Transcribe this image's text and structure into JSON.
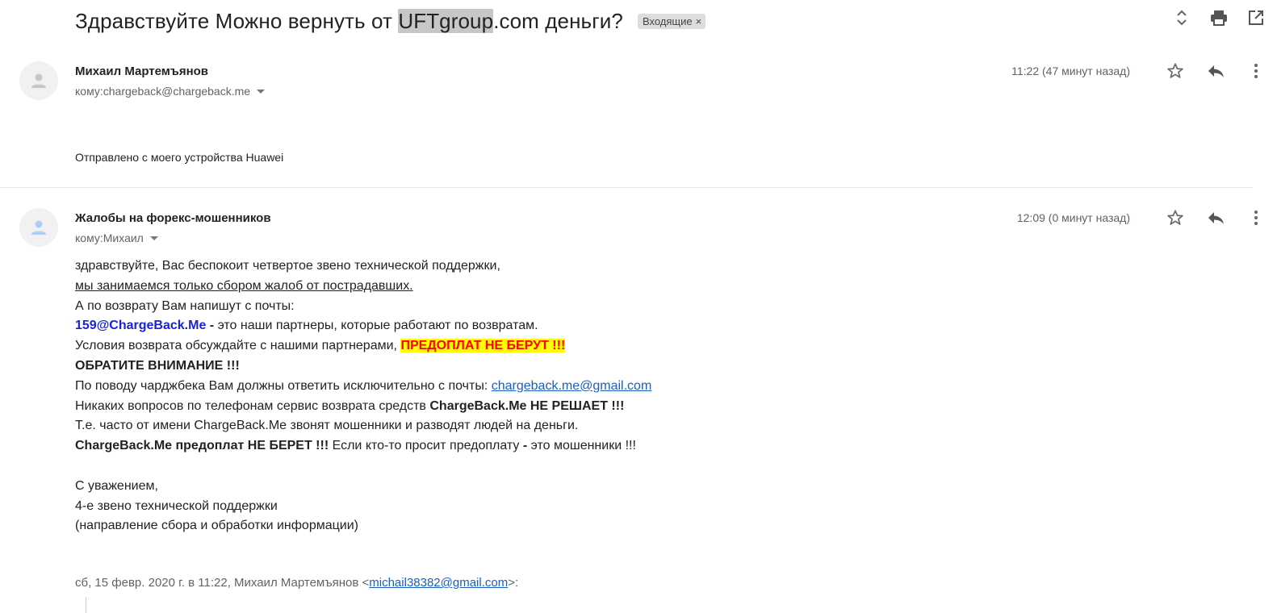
{
  "header": {
    "subject_before": "Здравствуйте Можно вернуть от ",
    "subject_highlight": "UFTgroup",
    "subject_after": ".com деньги?",
    "label": "Входящие",
    "label_close": "×"
  },
  "messages": [
    {
      "sender": "Михаил Мартемъянов",
      "to_prefix": "кому: ",
      "to": "chargeback@chargeback.me",
      "time": "11:22 (47 минут назад)",
      "signature": "Отправлено с моего устройства Huawei"
    },
    {
      "sender": "Жалобы на форекс-мошенников",
      "to_prefix": "кому: ",
      "to": "Михаил",
      "time": "12:09 (0 минут назад)"
    }
  ],
  "body": {
    "line1": "здравствуйте, Вас беспокоит четвертое звено технической поддержки,",
    "line2": "мы занимаемся только сбором жалоб от пострадавших.",
    "line3": "А по возврату Вам напишут с почты:",
    "line4_email": "159@ChargeBack.Me",
    "line4_dash": " - ",
    "line4_rest": "это наши партнеры, которые работают по возвратам.",
    "line5": "Условия возврата обсуждайте с нашими партнерами, ",
    "line5_warn": "ПРЕДОПЛАТ НЕ БЕРУТ !!!",
    "line6": "ОБРАТИТЕ ВНИМАНИЕ !!!",
    "line7": "По поводу чарджбека Вам должны ответить исключительно с почты: ",
    "line7_link": "chargeback.me@gmail.com",
    "line8": "Никаких вопросов по телефонам сервис возврата средств ",
    "line8_bold": "ChargeBack.Me НЕ РЕШАЕТ !!!",
    "line9": "Т.е. часто от имени ChargeBack.Me звонят мошенники и разводят людей на деньги.",
    "line10_bold": "ChargeBack.Me предоплат НЕ БЕРЕТ !!!",
    "line10_mid": " Если кто-то просит предоплату ",
    "line10_dash": "-",
    "line10_end": " это мошенники !!!",
    "regards": "С уважением,",
    "team": "4-е звено технической поддержки",
    "dept": "(направление сбора и обработки информации)",
    "quoted_prefix": "сб, 15 февр. 2020 г. в 11:22, Михаил Мартемъянов <",
    "quoted_email": "michail38382@gmail.com",
    "quoted_suffix": ">:"
  },
  "icons": [
    "expand-collapse-icon",
    "print-icon",
    "open-new-window-icon",
    "avatar-person-icon",
    "star-icon",
    "reply-icon",
    "more-vert-icon"
  ]
}
